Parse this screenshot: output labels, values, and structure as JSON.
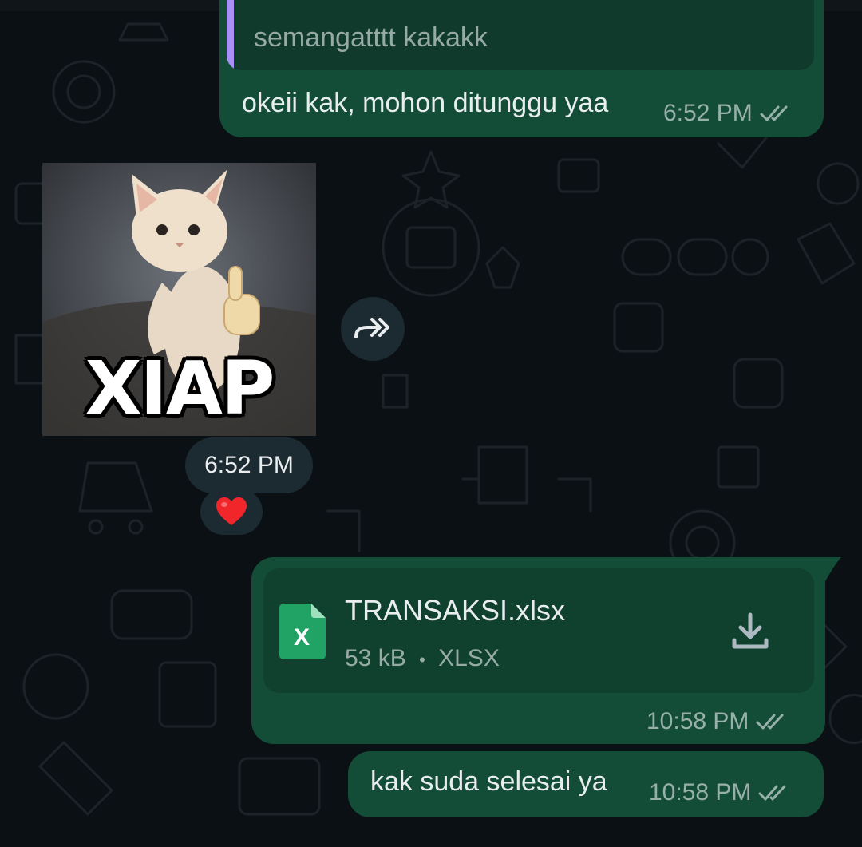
{
  "messages": {
    "reply": {
      "quoted_text": "semangatttt kakakk",
      "text": "okeii kak, mohon ditunggu yaa",
      "time": "6:52 PM"
    },
    "sticker": {
      "caption": "XIAP",
      "time": "6:52 PM",
      "reaction": "❤️"
    },
    "file": {
      "name": "TRANSAKSI.xlsx",
      "size": "53 kB",
      "separator": "•",
      "type": "XLSX",
      "icon_letter": "X",
      "time": "10:58 PM"
    },
    "last": {
      "text": "kak suda selesai ya",
      "time": "10:58 PM"
    }
  },
  "icons": {
    "read_status": "double-check-icon",
    "forward": "forward-icon",
    "download": "download-icon",
    "file_type": "excel-file-icon"
  },
  "colors": {
    "background": "#0b1014",
    "outgoing_bubble": "#144d37",
    "quote_bar": "#a791f7",
    "excel_green": "#21a366"
  }
}
